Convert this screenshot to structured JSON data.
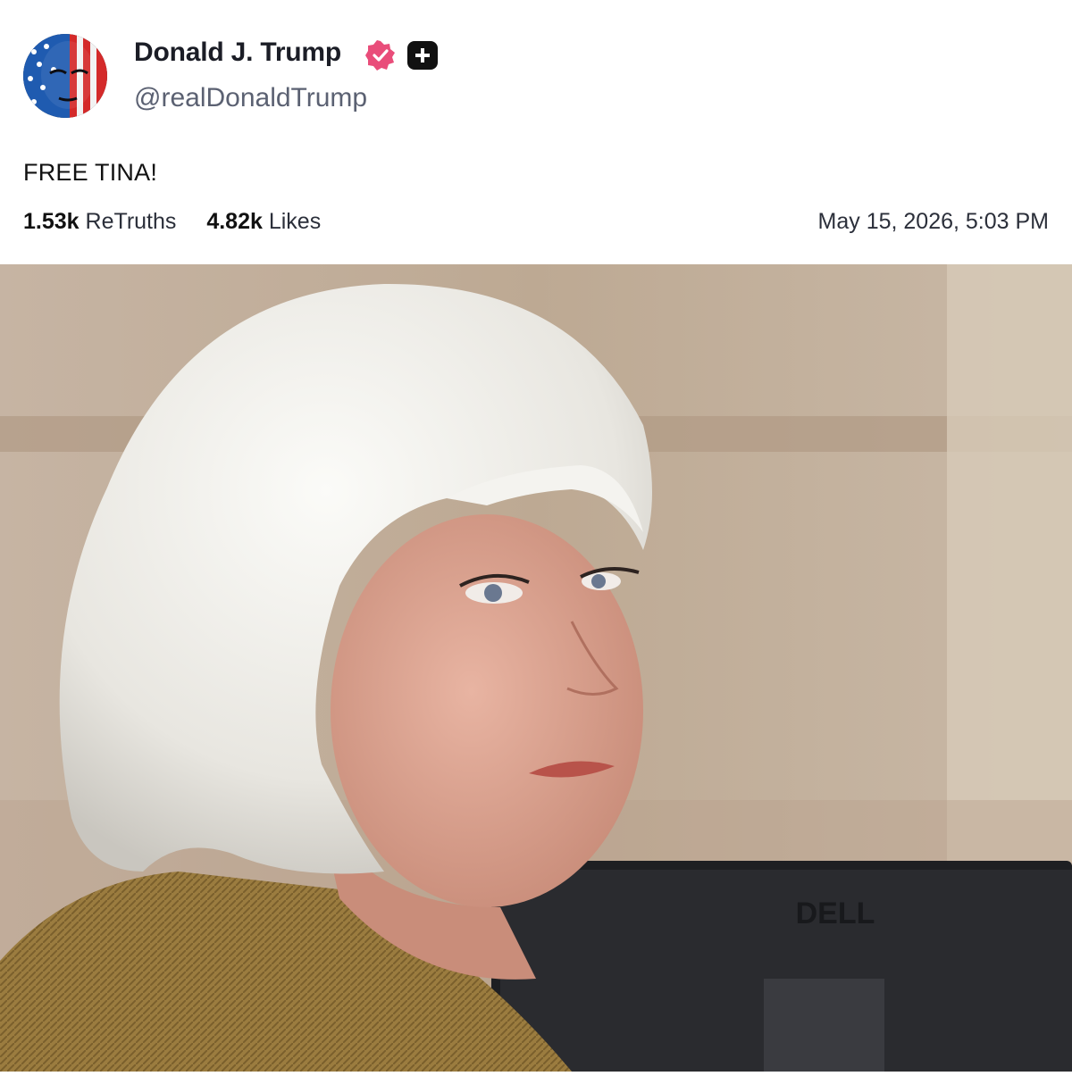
{
  "author": {
    "display_name": "Donald J. Trump",
    "handle": "@realDonaldTrump",
    "verified_icon": "verified-badge-icon",
    "extra_icon": "plus-badge-icon"
  },
  "post": {
    "text": "FREE TINA!",
    "retruths_count": "1.53k",
    "retruths_label": "ReTruths",
    "likes_count": "4.82k",
    "likes_label": "Likes",
    "timestamp": "May 15, 2026, 5:03 PM"
  },
  "image": {
    "monitor_brand_text": "DELL"
  },
  "colors": {
    "verified_pink": "#e94d7a",
    "plus_badge_bg": "#111111",
    "handle_gray": "#5b6172"
  }
}
